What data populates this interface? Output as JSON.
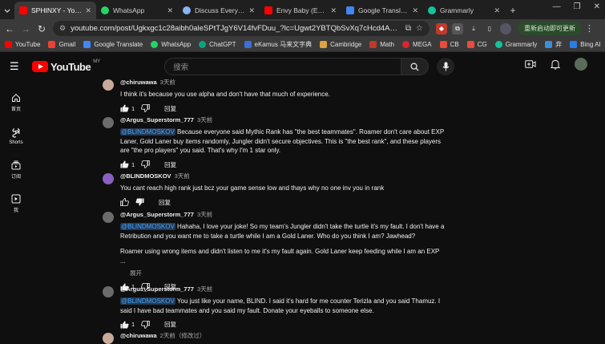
{
  "browser": {
    "tabs": [
      {
        "label": "SPHINXY - YouTube",
        "color": "#ff0000",
        "active": true
      },
      {
        "label": "WhatsApp",
        "color": "#25d366",
        "active": false
      },
      {
        "label": "Discuss Everything",
        "color": "#8ab4f8",
        "active": false
      },
      {
        "label": "Envy Baby (English",
        "color": "#ff0000",
        "active": false
      },
      {
        "label": "Google Translate",
        "color": "#4285f4",
        "active": false
      },
      {
        "label": "Grammarly",
        "color": "#15c39a",
        "active": false
      }
    ],
    "url": "youtube.com/post/Ugkxgc1c28aibh0aleSPtTJgY6V14fvFDuu_?lc=Ugwt2YBTQbSvXq7cHcd4AaABAg.9zz6tsFPf4GA-...",
    "update_label": "重新启动即可更新",
    "bookmarks": [
      {
        "label": "YouTube",
        "color": "#ff0000"
      },
      {
        "label": "Gmail",
        "color": "#ea4335"
      },
      {
        "label": "Google Translate",
        "color": "#4285f4"
      },
      {
        "label": "WhatsApp",
        "color": "#25d366"
      },
      {
        "label": "ChatGPT",
        "color": "#10a37f"
      },
      {
        "label": "eKamus 马来文字典",
        "color": "#3b6ed6"
      },
      {
        "label": "Cambridge",
        "color": "#d9a441"
      },
      {
        "label": "Math",
        "color": "#c0392b"
      },
      {
        "label": "MEGA",
        "color": "#d9272e"
      },
      {
        "label": "CB",
        "color": "#e74c3c"
      },
      {
        "label": "CG",
        "color": "#e74c3c"
      },
      {
        "label": "Grammarly",
        "color": "#15c39a"
      },
      {
        "label": "弃",
        "color": "#3b8fd6"
      },
      {
        "label": "Bing AI",
        "color": "#2a7de1"
      }
    ]
  },
  "youtube": {
    "logo_text": "YouTube",
    "region": "MY",
    "search_placeholder": "搜索",
    "sidebar": [
      {
        "label": "首页",
        "icon": "home-icon"
      },
      {
        "label": "Shorts",
        "icon": "shorts-icon"
      },
      {
        "label": "订阅",
        "icon": "subscriptions-icon"
      },
      {
        "label": "我",
        "icon": "you-icon"
      }
    ]
  },
  "comments": [
    {
      "author": "@chiruwawa",
      "time": "3天前",
      "avatar_color": "#c9a99a",
      "text": "I think it's because you use alpha and don't have that much of experience.",
      "likes": "1",
      "liked": true,
      "reply": "回复"
    },
    {
      "author": "@Argus_Superstorm_777",
      "time": "3天前",
      "avatar_color": "#6b6b6b",
      "mention": "@BLINDMOSKOV",
      "text": " Because everyone said Mythic Rank has \"the best teammates\". Roamer don't care about EXP Laner, Gold Laner buy items randomly, Jungler didn't secure objectives. This is \"the best rank\", and these players are \"the pro players\" you said. That's why I'm 1 star only.",
      "likes": "1",
      "liked": true,
      "reply": "回复"
    },
    {
      "author": "@BLINDMOSKOV",
      "time": "3天前",
      "avatar_color": "#8b5fbf",
      "text": "You cant reach high rank just bcz your game sense low and thays why no one inv you in rank",
      "likes": "",
      "liked": false,
      "disliked": true,
      "reply": "回复"
    },
    {
      "author": "@Argus_Superstorm_777",
      "time": "3天前",
      "avatar_color": "#6b6b6b",
      "mention": "@BLINDMOSKOV",
      "text": " Hahaha, I love your joke! So my team's Jungler didn't take the turtle it's my fault. I don't have a Retribution and you want me to take a turtle while I am a Gold Laner. Who do you think I am? Jawhead?",
      "text2": "Roamer using wrong items and didn't listen to me it's my fault again. Gold Laner keep feeding while I am an EXP ...",
      "collapse": "展开",
      "likes": "1",
      "liked": true,
      "reply": "回复"
    },
    {
      "author": "@Argus_Superstorm_777",
      "time": "3天前",
      "avatar_color": "#6b6b6b",
      "mention": "@BLINDMOSKOV",
      "text": " You just like your name, BLIND. I said it's hard for me counter Terizla and you said Thamuz. I said I have bad teammates and you said my fault. Donate your eyeballs to someone else.",
      "likes": "1",
      "liked": true,
      "reply": "回复"
    },
    {
      "author": "@chiruwawa",
      "time": "2天前（修改过）",
      "avatar_color": "#c9a99a",
      "text": "",
      "likes": "",
      "reply": ""
    }
  ]
}
